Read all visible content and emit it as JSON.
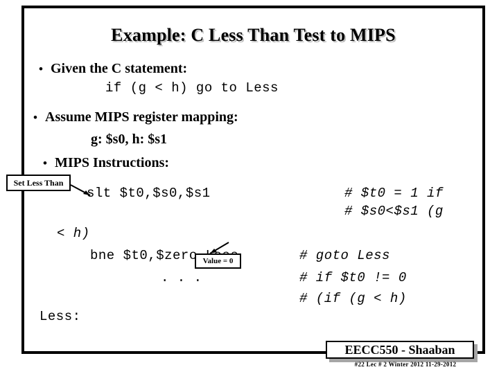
{
  "slide": {
    "title": "Example:  C Less Than Test to MIPS",
    "bullets": [
      {
        "marker": "•",
        "label": "Given the C statement:"
      },
      {
        "marker": "•",
        "label": "Assume MIPS register mapping:"
      },
      {
        "marker": "•",
        "label": "MIPS Instructions:"
      }
    ],
    "sublines": [
      {
        "text": "g: $s0,  h: $s1"
      }
    ],
    "c_statement": "if (g < h) go to Less",
    "code_lines": [
      {
        "text": "slt $t0,$s0,$s1"
      },
      {
        "text": "< h)"
      },
      {
        "text": "bne $t0,$zero,Less"
      },
      {
        "text": ". . ."
      },
      {
        "text": "Less:"
      }
    ],
    "comments": [
      {
        "text": "# $t0 = 1 if"
      },
      {
        "text": "# $s0<$s1 (g"
      },
      {
        "text": "# goto Less"
      },
      {
        "text": "# if $t0 != 0"
      },
      {
        "text": "# (if (g < h)"
      }
    ],
    "callouts": [
      {
        "id": "set-less-than",
        "text": "Set Less Than"
      },
      {
        "id": "value-zero",
        "text": "Value = 0"
      }
    ],
    "footer": {
      "badge": "EECC550 - Shaaban",
      "meta": "#22   Lec # 2   Winter 2012  11-29-2012"
    },
    "colors": {
      "text": "#000000",
      "background": "#ffffff",
      "title_shadow": "#bfbfbf",
      "badge_shadow": "#a6a6a6"
    }
  }
}
